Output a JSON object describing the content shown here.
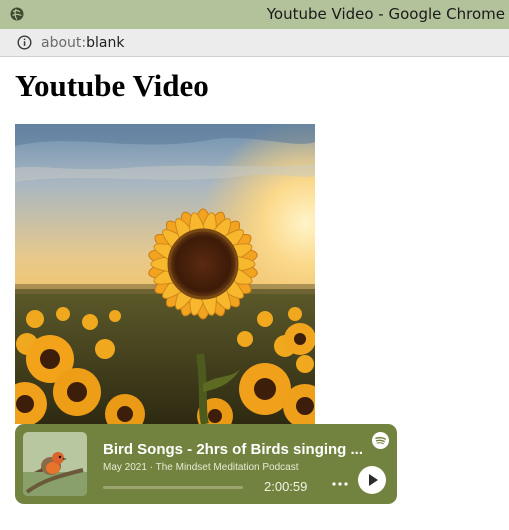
{
  "window": {
    "title": "Youtube Video - Google Chrome",
    "app_icon": "browser-globe-icon"
  },
  "addressbar": {
    "info_icon": "info-icon",
    "url_scheme": "about:",
    "url_path": "blank"
  },
  "page": {
    "heading": "Youtube Video",
    "image": "sunflower-field-photo"
  },
  "player": {
    "track_title": "Bird Songs - 2hrs of Birds singing ...",
    "track_subtitle": "May 2021 · The Mindset Meditation Podcast",
    "duration": "2:00:59",
    "progress_fraction": 0,
    "brand_icon": "spotify-icon",
    "more_icon": "more-dots-icon",
    "play_icon": "play-icon",
    "colors": {
      "background": "#72833f",
      "text": "#ffffff"
    }
  }
}
